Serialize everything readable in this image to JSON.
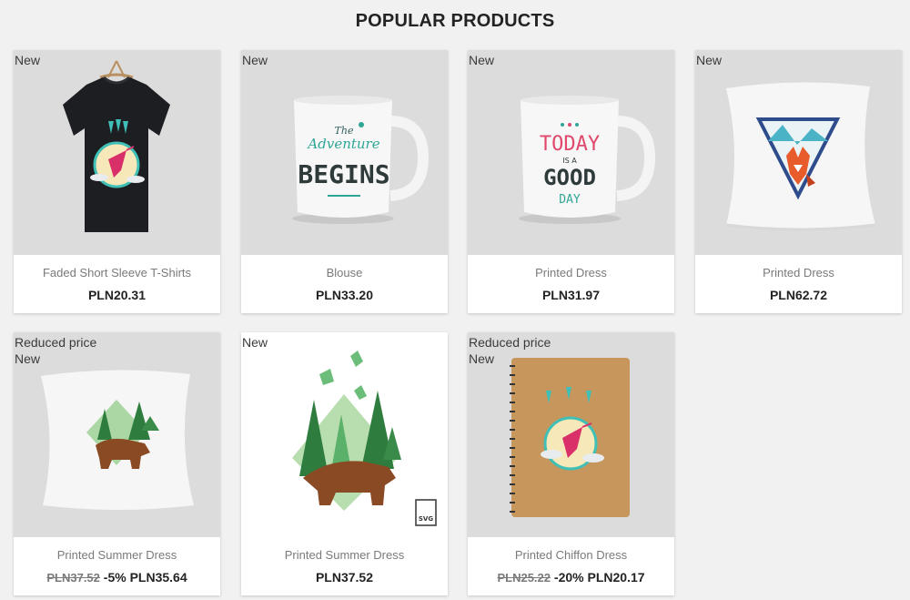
{
  "section": {
    "title": "POPULAR PRODUCTS"
  },
  "products": [
    {
      "flags": [
        "New"
      ],
      "name": "Faded Short Sleeve T-Shirts",
      "price": "PLN20.31",
      "icon": "tshirt-hummingbird"
    },
    {
      "flags": [
        "New"
      ],
      "name": "Blouse",
      "price": "PLN33.20",
      "icon": "mug-adventure-begins",
      "graphic_text": [
        "The",
        "Adventure",
        "BEGINS"
      ]
    },
    {
      "flags": [
        "New"
      ],
      "name": "Printed Dress",
      "price": "PLN31.97",
      "icon": "mug-today-good-day",
      "graphic_text": [
        "TODAY",
        "IS A",
        "GOOD",
        "DAY"
      ]
    },
    {
      "flags": [
        "New"
      ],
      "name": "Printed Dress",
      "price": "PLN62.72",
      "icon": "cushion-fox"
    },
    {
      "flags": [
        "Reduced price",
        "New"
      ],
      "name": "Printed Summer Dress",
      "old_price": "PLN37.52",
      "discount": "-5%",
      "price": "PLN35.64",
      "icon": "cushion-bear"
    },
    {
      "flags": [
        "New"
      ],
      "name": "Printed Summer Dress",
      "price": "PLN37.52",
      "icon": "bear-vector-graphic",
      "badge": "SVG"
    },
    {
      "flags": [
        "Reduced price",
        "New"
      ],
      "name": "Printed Chiffon Dress",
      "old_price": "PLN25.22",
      "discount": "-20%",
      "price": "PLN20.17",
      "icon": "notebook-hummingbird"
    }
  ],
  "colors": {
    "background": "#f1f1f1",
    "thumb": "#dcdcdc",
    "text": "#232323",
    "muted": "#7a7a7a"
  }
}
